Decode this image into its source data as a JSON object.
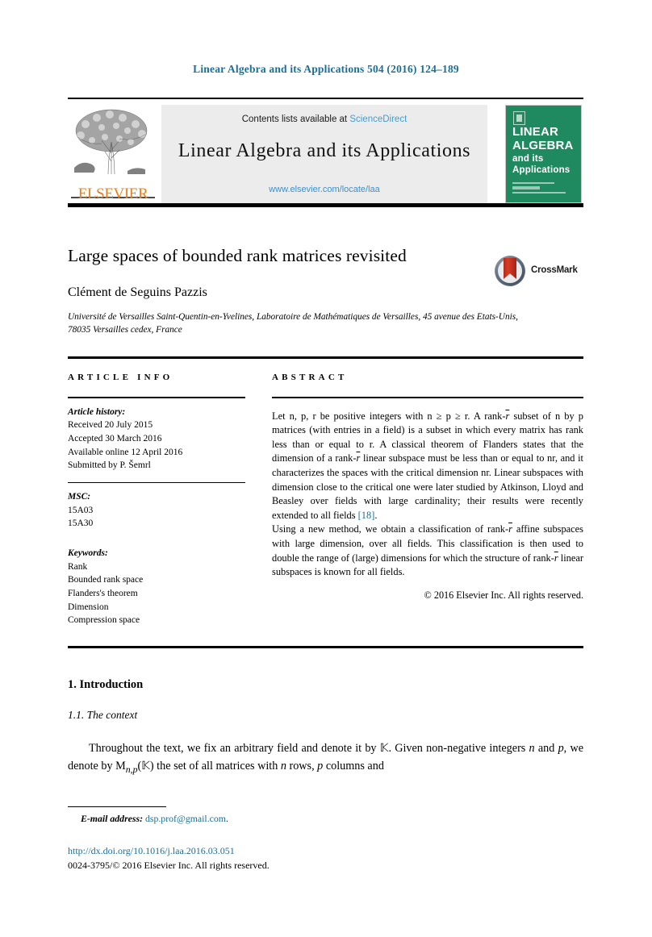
{
  "running_head": "Linear Algebra and its Applications 504 (2016) 124–189",
  "banner": {
    "contents_prefix": "Contents lists available at ",
    "sciencedirect": "ScienceDirect",
    "journal_title": "Linear Algebra and its Applications",
    "journal_url": "www.elsevier.com/locate/laa",
    "publisher_logo_text": "ELSEVIER",
    "cover": {
      "line1": "LINEAR",
      "line2": "ALGEBRA",
      "line3": "and its",
      "line4": "Applications"
    }
  },
  "article": {
    "title": "Large spaces of bounded rank matrices revisited",
    "crossmark_label": "CrossMark",
    "author": "Clément de Seguins Pazzis",
    "affiliation": "Université de Versailles Saint-Quentin-en-Yvelines, Laboratoire de Mathématiques de Versailles, 45 avenue des Etats-Unis, 78035 Versailles cedex, France"
  },
  "info": {
    "heading": "ARTICLE INFO",
    "history_label": "Article history:",
    "history": [
      "Received 20 July 2015",
      "Accepted 30 March 2016",
      "Available online 12 April 2016",
      "Submitted by P. Šemrl"
    ],
    "msc_label": "MSC:",
    "msc": [
      "15A03",
      "15A30"
    ],
    "keywords_label": "Keywords:",
    "keywords": [
      "Rank",
      "Bounded rank space",
      "Flanders's theorem",
      "Dimension",
      "Compression space"
    ]
  },
  "abstract": {
    "heading": "ABSTRACT",
    "p1_a": "Let n, p, r be positive integers with n ≥ p ≥ r. A rank-",
    "p1_r": "r",
    "p1_b": " subset of n by p matrices (with entries in a field) is a subset in which every matrix has rank less than or equal to r. A classical theorem of Flanders states that the dimension of a rank-",
    "p1_c": " linear subspace must be less than or equal to nr, and it characterizes the spaces with the critical dimension nr. Linear subspaces with dimension close to the critical one were later studied by Atkinson, Lloyd and Beasley over fields with large cardinality; their results were recently extended to all fields ",
    "p1_ref": "[18]",
    "p1_d": ".",
    "p2_a": "Using a new method, we obtain a classification of rank-",
    "p2_b": " affine subspaces with large dimension, over all fields. This classification is then used to double the range of (large) dimensions for which the structure of rank-",
    "p2_c": " linear subspaces is known for all fields.",
    "copyright": "© 2016 Elsevier Inc. All rights reserved."
  },
  "body": {
    "section_number_title": "1. Introduction",
    "subsection_number_title": "1.1. The context",
    "para_a": "Throughout the text, we fix an arbitrary field and denote it by ",
    "para_k1": "𝕂",
    "para_b": ". Given non-negative integers ",
    "para_n": "n",
    "para_c": " and ",
    "para_p": "p",
    "para_d": ", we denote by M",
    "para_sub": "n,p",
    "para_e": "(𝕂) the set of all matrices with ",
    "para_n2": "n",
    "para_f": " rows, ",
    "para_p2": "p",
    "para_g": " columns and"
  },
  "footer": {
    "email_label": "E-mail address:",
    "email_address": "dsp.prof@gmail.com",
    "email_period": ".",
    "doi": "http://dx.doi.org/10.1016/j.laa.2016.03.051",
    "issn_copyright": "0024-3795/© 2016 Elsevier Inc. All rights reserved."
  }
}
